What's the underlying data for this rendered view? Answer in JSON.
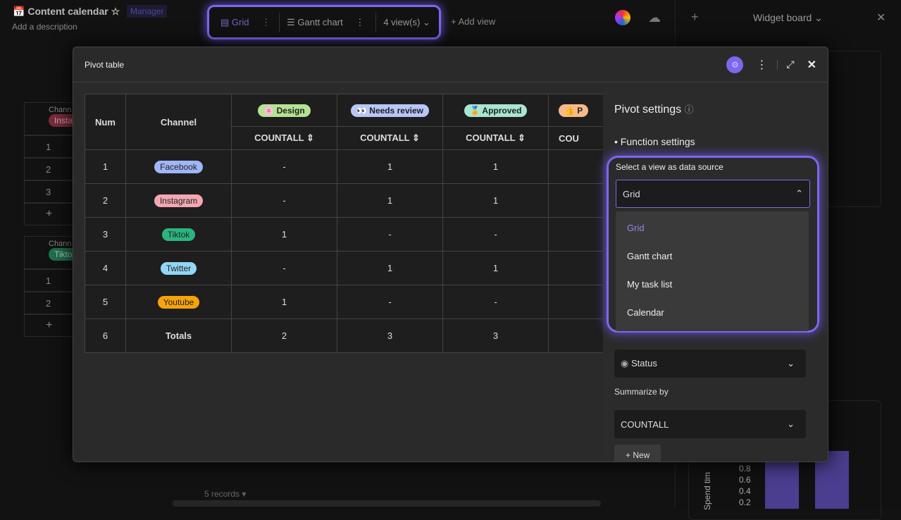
{
  "header": {
    "title": "Content calendar",
    "description": "Add a description",
    "role_badge": "Manager",
    "views": [
      {
        "label": "Grid",
        "icon": "grid-icon"
      },
      {
        "label": "Gantt chart",
        "icon": "gantt-icon"
      }
    ],
    "views_count": "4 view(s)",
    "add_view": "+ Add view"
  },
  "background_grid": {
    "group1": {
      "label": "Chann",
      "tag": "Insta",
      "rows": [
        "1",
        "2",
        "3"
      ]
    },
    "group2": {
      "label": "Chann",
      "tag": "Tikto",
      "rows": [
        "1",
        "2"
      ]
    },
    "records": "5 records ▾"
  },
  "widget_board": {
    "title": "Widget board",
    "chart_axis_label": "Spend tim",
    "ticks": [
      "0.8",
      "0.6",
      "0.4",
      "0.2"
    ],
    "bar_color": "#4b3d8f"
  },
  "modal": {
    "title": "Pivot table",
    "table": {
      "headers": {
        "num": "Num",
        "channel": "Channel",
        "statuses": [
          {
            "label": "Design",
            "color": "#b4e391",
            "emoji": "🌸"
          },
          {
            "label": "Needs review",
            "color": "#b8c6f8",
            "emoji": "👀"
          },
          {
            "label": "Approved",
            "color": "#a8e6cf",
            "emoji": "🏅"
          },
          {
            "label": "P",
            "color": "#f8b98a",
            "emoji": "👍"
          }
        ],
        "agg": "COUNTALL",
        "agg_partial": "COU"
      },
      "rows": [
        {
          "num": "1",
          "channel": "Facebook",
          "color": "#9fb6f7",
          "v": [
            "-",
            "1",
            "1"
          ]
        },
        {
          "num": "2",
          "channel": "Instagram",
          "color": "#f4a7b3",
          "v": [
            "-",
            "1",
            "1"
          ]
        },
        {
          "num": "3",
          "channel": "Tiktok",
          "color": "#2ab57f",
          "v": [
            "1",
            "-",
            "-"
          ]
        },
        {
          "num": "4",
          "channel": "Twitter",
          "color": "#92d6f6",
          "v": [
            "-",
            "1",
            "1"
          ]
        },
        {
          "num": "5",
          "channel": "Youtube",
          "color": "#f5a40a",
          "v": [
            "1",
            "-",
            "-"
          ]
        }
      ],
      "totals": {
        "num": "6",
        "label": "Totals",
        "v": [
          "2",
          "3",
          "3"
        ]
      }
    },
    "settings": {
      "title": "Pivot settings",
      "section": "Function settings",
      "source_label": "Select a view as data source",
      "source_value": "Grid",
      "options": [
        "Grid",
        "Gantt chart",
        "My task list",
        "Calendar"
      ],
      "column_field": "Status",
      "summarize_label": "Summarize by",
      "summarize_value": "COUNTALL",
      "new_button": "+ New"
    }
  },
  "colors": {
    "accent": "#7b68ee"
  }
}
